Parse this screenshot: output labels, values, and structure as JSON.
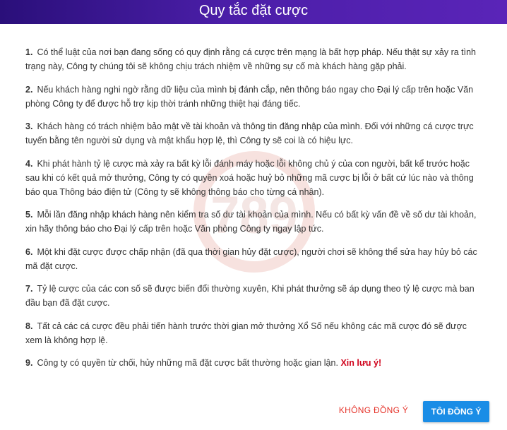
{
  "dialog": {
    "title": "Quy tắc đặt cược",
    "rules": [
      {
        "num": "1.",
        "text": "Có thể luật của nơi bạn đang sống có quy định rằng cá cược trên mạng là bất hợp pháp. Nếu thật sự xảy ra tình trạng này, Công ty chúng tôi sẽ không chịu trách nhiệm về những sự cố mà khách hàng gặp phải."
      },
      {
        "num": "2.",
        "text": "Nếu khách hàng nghi ngờ rằng dữ liệu của mình bị đánh cắp, nên thông báo ngay cho Đại lý cấp trên hoặc Văn phòng Công ty để được hỗ trợ kịp thời tránh những thiệt hại đáng tiếc."
      },
      {
        "num": "3.",
        "text": "Khách hàng có trách nhiệm bảo mật về tài khoản và thông tin đăng nhập của mình. Đối với những cá cược trực tuyến bằng tên người sử dụng và mật khẩu hợp lệ, thì Công ty sẽ coi là có hiệu lực."
      },
      {
        "num": "4.",
        "text": "Khi phát hành tỷ lệ cược mà xảy ra bất kỳ lỗi đánh máy hoặc lỗi không chủ ý của con người, bất kể trước hoặc sau khi có kết quả mở thưởng, Công ty có quyền xoá hoặc huỷ bỏ những mã cược bị lỗi ở bất cứ lúc nào và thông báo qua Thông báo điện tử (Công ty sẽ không thông báo cho từng cá nhân)."
      },
      {
        "num": "5.",
        "text": "Mỗi lần đăng nhập khách hàng nên kiểm tra số dư tài khoản của mình. Nếu có bất kỳ vấn đề về số dư tài khoản, xin hãy thông báo cho Đại lý cấp trên hoặc Văn phòng Công ty ngay lập tức."
      },
      {
        "num": "6.",
        "text": "Một khi đặt cược được chấp nhận (đã qua thời gian hủy đặt cược), người chơi sẽ không thể sửa hay hủy bỏ các mã đặt cược."
      },
      {
        "num": "7.",
        "text": "Tỷ lệ cược của các con số sẽ được biến đổi thường xuyên, Khi phát thưởng sẽ áp dụng theo tỷ lệ cược mà ban đầu bạn đã đặt cược."
      },
      {
        "num": "8.",
        "text": "Tất cả các cá cược đều phải tiến hành trước thời gian mở thưởng Xổ Số nếu không các mã cược đó sẽ được xem là không hợp lệ."
      },
      {
        "num": "9.",
        "text": "Công ty có quyền từ chối, hủy những mã đặt cược bất thường hoặc gian lận.",
        "warning": "Xin lưu ý!"
      }
    ],
    "decline_label": "KHÔNG ĐỒNG Ý",
    "accept_label": "TÔI ĐỒNG Ý"
  },
  "watermark_text": "789",
  "colors": {
    "header_start": "#2a0f7a",
    "header_end": "#5a24b8",
    "accept_button": "#1a8de6",
    "decline_text": "#e5332a",
    "warning_text": "#d0021b"
  },
  "icons": {
    "watermark": "logo-watermark-icon"
  }
}
